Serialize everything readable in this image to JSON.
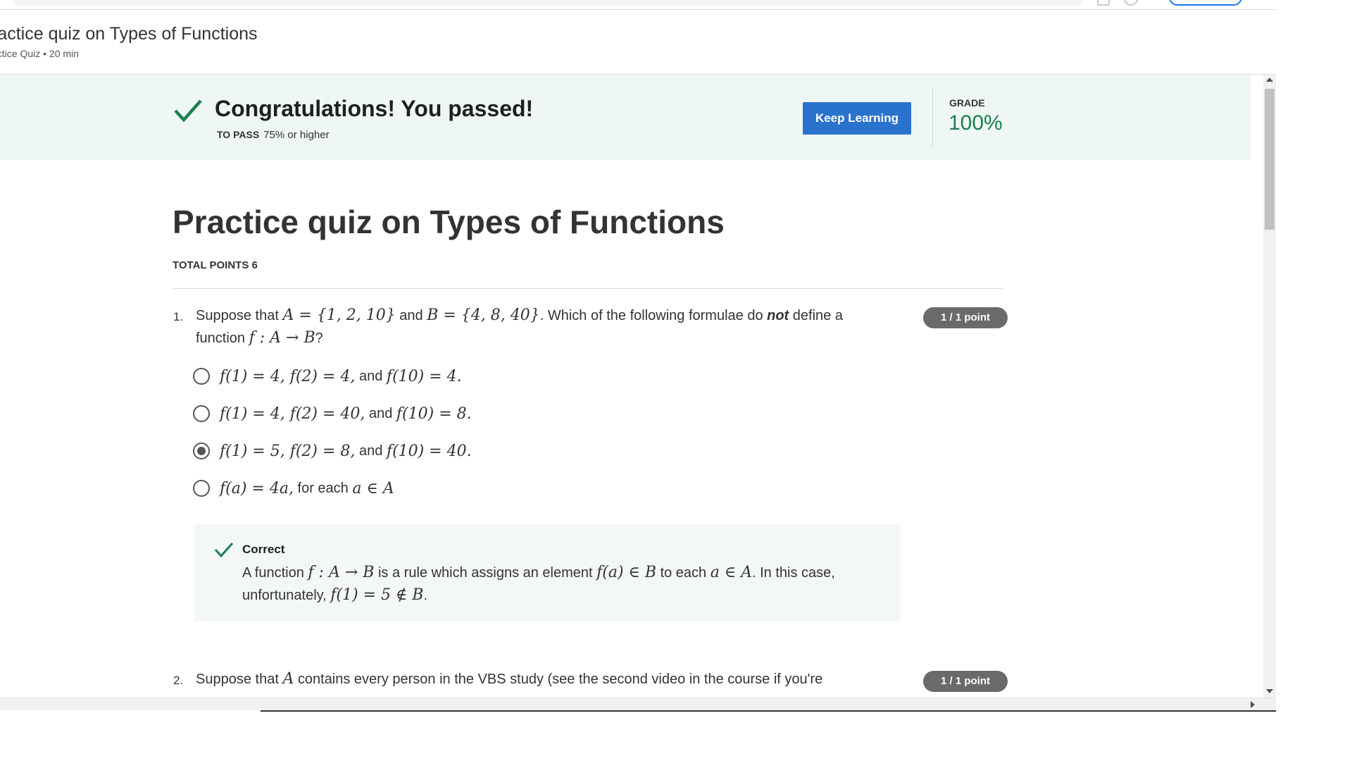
{
  "header": {
    "title": "ractice quiz on Types of Functions",
    "subtitle": "actice Quiz • 20 min"
  },
  "banner": {
    "title": "Congratulations! You passed!",
    "to_pass_label": "TO PASS",
    "to_pass_value": "75% or higher",
    "keep_learning_label": "Keep Learning",
    "grade_label": "GRADE",
    "grade_value": "100%"
  },
  "quiz": {
    "title": "Practice quiz on Types of Functions",
    "total_points": "TOTAL POINTS 6"
  },
  "questions": [
    {
      "number": "1.",
      "points": "1 / 1 point",
      "text_part1": "Suppose that ",
      "text_math1": "A = {1, 2, 10}",
      "text_part2": " and ",
      "text_math2": "B = {4, 8, 40}",
      "text_part3": ". Which of the following formulae do ",
      "text_emph": "not",
      "text_part4": " define a function ",
      "text_math3": "f : A → B",
      "text_part5": "?",
      "options": [
        {
          "math1": "f(1) = 4, f(2) = 4,",
          "word": " and ",
          "math2": "f(10) = 4.",
          "selected": false
        },
        {
          "math1": "f(1) = 4, f(2) = 40,",
          "word": " and ",
          "math2": "f(10) = 8.",
          "selected": false
        },
        {
          "math1": "f(1) = 5, f(2) = 8,",
          "word": " and ",
          "math2": "f(10) = 40.",
          "selected": true
        },
        {
          "math1": "f(a) = 4a,",
          "word": " for each ",
          "math2": "a ∈ A",
          "selected": false
        }
      ],
      "feedback": {
        "title": "Correct",
        "t1": "A function ",
        "m1": "f : A → B",
        "t2": " is a rule which assigns an element ",
        "m2": "f(a) ∈ B",
        "t3": " to each ",
        "m3": "a ∈ A",
        "t4": ". In this case, unfortunately, ",
        "m4": "f(1) = 5 ∉ B",
        "t5": "."
      }
    },
    {
      "number": "2.",
      "points": "1 / 1 point",
      "text_part1": "Suppose that ",
      "text_math1": "A",
      "text_part2": " contains every person in the VBS study (see the second video in the course if you're"
    }
  ]
}
